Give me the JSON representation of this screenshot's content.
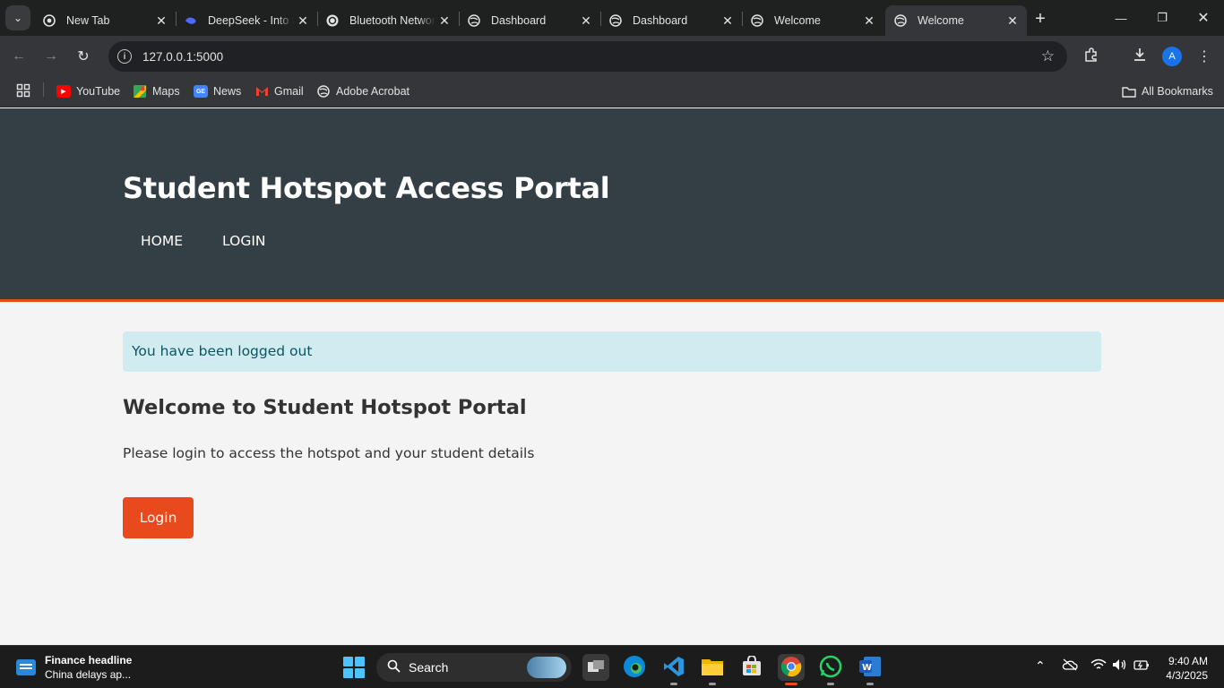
{
  "browser": {
    "tabs": [
      {
        "title": "New Tab",
        "icon": "chrome-icon"
      },
      {
        "title": "DeepSeek - Into the Unknown",
        "icon": "deepseek-icon"
      },
      {
        "title": "Bluetooth Network",
        "icon": "chatgpt-icon"
      },
      {
        "title": "Dashboard",
        "icon": "globe-icon"
      },
      {
        "title": "Dashboard",
        "icon": "globe-icon"
      },
      {
        "title": "Welcome",
        "icon": "globe-icon"
      },
      {
        "title": "Welcome",
        "icon": "globe-icon",
        "active": true
      }
    ],
    "url": "127.0.0.1:5000",
    "profile_initial": "A",
    "bookmarks": [
      {
        "label": "YouTube",
        "icon": "youtube-icon"
      },
      {
        "label": "Maps",
        "icon": "maps-icon"
      },
      {
        "label": "News",
        "icon": "news-icon"
      },
      {
        "label": "Gmail",
        "icon": "gmail-icon"
      },
      {
        "label": "Adobe Acrobat",
        "icon": "globe-icon"
      }
    ],
    "all_bookmarks_label": "All Bookmarks"
  },
  "page": {
    "header": {
      "title": "Student Hotspot Access Portal",
      "nav": [
        "HOME",
        "LOGIN"
      ]
    },
    "flash_message": "You have been logged out",
    "welcome_heading": "Welcome to Student Hotspot Portal",
    "subtitle": "Please login to access the hotspot and your student details",
    "login_button": "Login",
    "colors": {
      "header_bg": "#343e45",
      "accent": "#e8491d",
      "flash_bg": "#d1ecf1",
      "flash_text": "#0c5460"
    }
  },
  "taskbar": {
    "news_title": "Finance headline",
    "news_sub": "China delays ap...",
    "search_placeholder": "Search",
    "time": "9:40 AM",
    "date": "4/3/2025"
  }
}
